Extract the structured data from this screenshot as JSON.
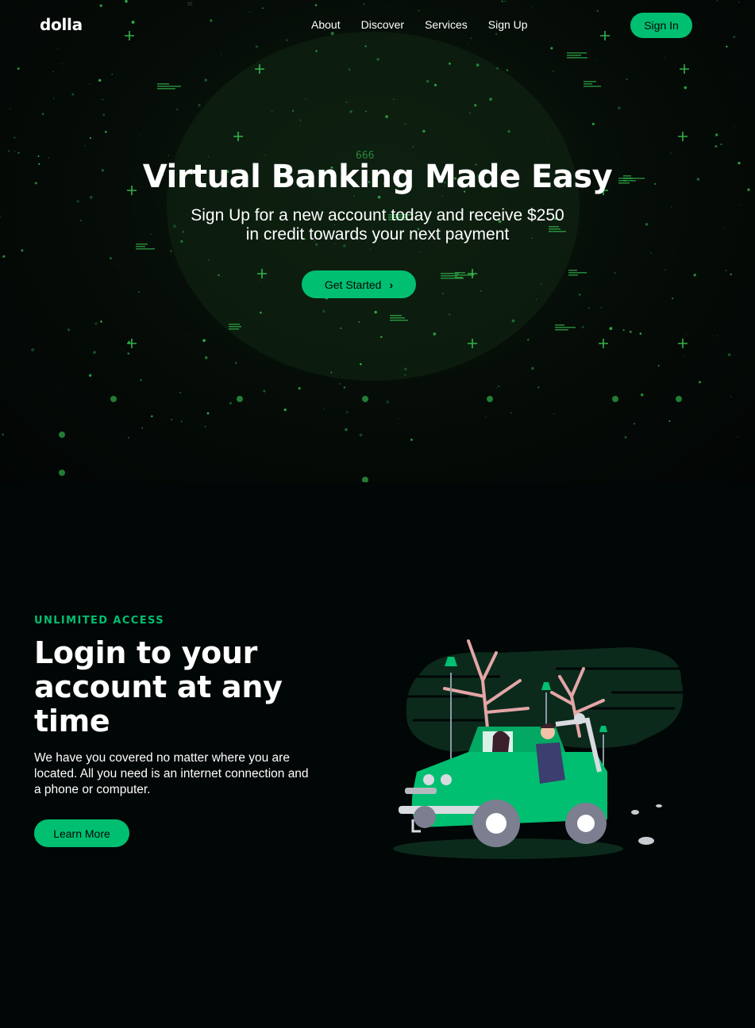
{
  "nav": {
    "logo": "dolla",
    "links": [
      "About",
      "Discover",
      "Services",
      "Sign Up"
    ],
    "signin_label": "Sign In"
  },
  "hero": {
    "title": "Virtual Banking Made Easy",
    "subtitle_line1": "Sign Up for a new account today and receive $250",
    "subtitle_line2": "in credit towards your next payment",
    "cta_label": "Get Started",
    "cta_icon": "chevron-right-icon",
    "bg_digits": "666"
  },
  "info": {
    "topline": "UNLIMITED ACCESS",
    "heading": "Login to your account at any time",
    "description": "We have you covered no matter where you are located. All you need is an internet connection and a phone or computer.",
    "button_label": "Learn More",
    "illustration": "car-illustration"
  },
  "colors": {
    "accent": "#01bf71",
    "background": "#010606",
    "text": "#ffffff"
  }
}
